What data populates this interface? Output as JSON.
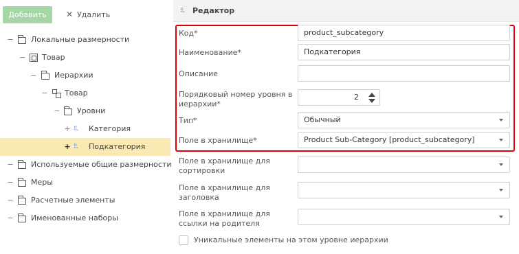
{
  "toolbar": {
    "add_label": "Добавить",
    "delete_label": "Удалить"
  },
  "tree": [
    {
      "label": "Локальные размерности",
      "toggle": "−",
      "icon": "folder-icon"
    },
    {
      "label": "Товар",
      "toggle": "−",
      "icon": "cube-icon"
    },
    {
      "label": "Иерархии",
      "toggle": "−",
      "icon": "folder-icon"
    },
    {
      "label": "Товар",
      "toggle": "−",
      "icon": "hierarchy-icon"
    },
    {
      "label": "Уровни",
      "toggle": "−",
      "icon": "folder-icon"
    },
    {
      "label": "Категория",
      "toggle": "+",
      "icon": "level-icon"
    },
    {
      "label": "Подкатегория",
      "toggle": "+",
      "icon": "level-icon",
      "selected": true
    },
    {
      "label": "Используемые общие размерности",
      "toggle": "−",
      "icon": "folder-icon"
    },
    {
      "label": "Меры",
      "toggle": "−",
      "icon": "folder-icon"
    },
    {
      "label": "Расчетные элементы",
      "toggle": "−",
      "icon": "folder-icon"
    },
    {
      "label": "Именованные наборы",
      "toggle": "−",
      "icon": "folder-icon"
    }
  ],
  "editor": {
    "title": "Редактор",
    "fields": {
      "code": {
        "label": "Код*",
        "value": "product_subcategory"
      },
      "name": {
        "label": "Наименование*",
        "value": "Подкатегория"
      },
      "description": {
        "label": "Описание",
        "value": ""
      },
      "level_number": {
        "label": "Порядковый номер уровня в иерархии*",
        "value": "2"
      },
      "type": {
        "label": "Тип*",
        "value": "Обычный"
      },
      "storage_field": {
        "label": "Поле в хранилище*",
        "value": "Product Sub-Category [product_subcategory]"
      },
      "sort_field": {
        "label": "Поле в хранилище для сортировки",
        "value": ""
      },
      "caption_field": {
        "label": "Поле в хранилище для заголовка",
        "value": ""
      },
      "parent_link_field": {
        "label": "Поле в хранилище для ссылки на родителя",
        "value": ""
      }
    },
    "unique_members": {
      "label": "Уникальные элементы на этом уровне иерархии",
      "checked": false
    }
  },
  "colors": {
    "add_button": "#a5d6a7",
    "selected_row": "#fbe9b3",
    "highlight_box": "#e0000a",
    "level_icon": "#5a6fb0"
  }
}
